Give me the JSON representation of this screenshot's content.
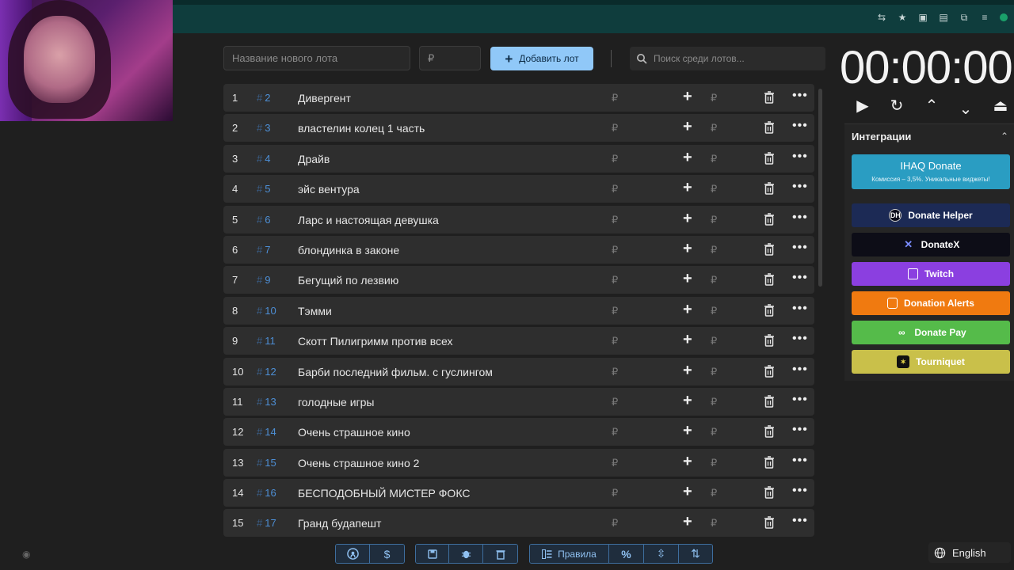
{
  "form": {
    "lot_name_placeholder": "Название нового лота",
    "amount_placeholder": "₽",
    "add_label": "Добавить лот",
    "search_placeholder": "Поиск среди лотов..."
  },
  "currency": "₽",
  "lots": [
    {
      "num": "1",
      "id": "2",
      "name": "Дивергент"
    },
    {
      "num": "2",
      "id": "3",
      "name": "властелин колец 1 часть"
    },
    {
      "num": "3",
      "id": "4",
      "name": "Драйв"
    },
    {
      "num": "4",
      "id": "5",
      "name": "эйс вентура"
    },
    {
      "num": "5",
      "id": "6",
      "name": "Ларс и настоящая девушка"
    },
    {
      "num": "6",
      "id": "7",
      "name": "блондинка в законе"
    },
    {
      "num": "7",
      "id": "9",
      "name": "Бегущий по лезвию"
    },
    {
      "num": "8",
      "id": "10",
      "name": "Тэмми"
    },
    {
      "num": "9",
      "id": "11",
      "name": "Скотт Пилигримм против всех"
    },
    {
      "num": "10",
      "id": "12",
      "name": "Барби последний фильм. с гуслингом"
    },
    {
      "num": "11",
      "id": "13",
      "name": "голодные игры"
    },
    {
      "num": "12",
      "id": "14",
      "name": "Очень страшное кино"
    },
    {
      "num": "13",
      "id": "15",
      "name": "Очень страшное кино 2"
    },
    {
      "num": "14",
      "id": "16",
      "name": "БЕСПОДОБНЫЙ МИСТЕР ФОКС"
    },
    {
      "num": "15",
      "id": "17",
      "name": "Гранд будапешт"
    }
  ],
  "timer": {
    "display": "00:00:00"
  },
  "integrations": {
    "title": "Интеграции",
    "ihaq": {
      "label": "IHAQ Donate",
      "subtitle": "Комиссия – 3,5%. Уникальные виджеты!"
    },
    "buttons": [
      {
        "label": "Donate Helper",
        "color": "#1c2a55"
      },
      {
        "label": "DonateX",
        "color": "#0d0d17"
      },
      {
        "label": "Twitch",
        "color": "#8b3fe0"
      },
      {
        "label": "Donation Alerts",
        "color": "#f07a10"
      },
      {
        "label": "Donate Pay",
        "color": "#55bb4a"
      },
      {
        "label": "Tourniquet",
        "color": "#c9c04a"
      }
    ]
  },
  "toolbar": {
    "rules_label": "Правила",
    "percent_label": "%"
  },
  "language": {
    "label": "English"
  },
  "icons": {
    "github": "github-icon",
    "dollar": "dollar-icon",
    "save": "save-icon",
    "bug": "bug-icon",
    "trash": "trash-icon",
    "rules": "rules-icon",
    "percent": "percent-icon",
    "split": "split-icon",
    "sort": "sort-icon",
    "globe": "globe-icon",
    "eye": "eye-icon"
  }
}
